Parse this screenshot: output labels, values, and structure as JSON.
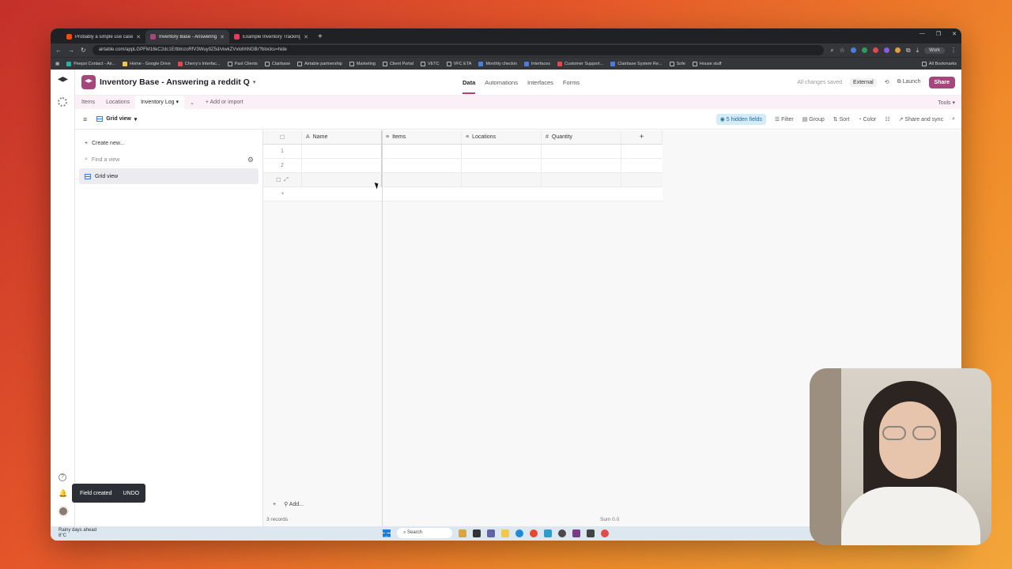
{
  "browser": {
    "tabs": [
      {
        "title": "Probably a simple use case, bu",
        "color": "#ff4500"
      },
      {
        "title": "Inventory Base - Answering a re",
        "color": "#a5477b"
      },
      {
        "title": "Example Inventory Tracking: In",
        "color": "#e63b5a"
      }
    ],
    "new_tab": "+",
    "url": "airtable.com/appLGPFM16kC2dc1E/tblnzoRfV3Wuy9Z5d/viwkZVvlohhNGBr?blocks=hide",
    "profile": "Work",
    "bookmarks": [
      "Peepsi Contact - Air...",
      "Home - Google Drive",
      "Cherry's Interfac...",
      "Past Clients",
      "Clairbase",
      "Airtable partnership",
      "Marketing",
      "Client Portal",
      "VETC",
      "VFC ETA",
      "Monthly checkin",
      "Interfaces",
      "Customer Support...",
      "Clairbase System Re...",
      "Sofe",
      "House stuff"
    ],
    "all_bookmarks": "All Bookmarks"
  },
  "base": {
    "name": "Inventory Base - Answering a reddit Q",
    "nav": [
      "Data",
      "Automations",
      "Interfaces",
      "Forms"
    ],
    "saved": "All changes saved",
    "external": "External",
    "launch": "Launch",
    "share": "Share"
  },
  "tables": {
    "items": [
      "Items",
      "Locations"
    ],
    "active": "Inventory Log",
    "add": "Add or import",
    "tools": "Tools"
  },
  "viewbar": {
    "view_name": "Grid view",
    "hidden_fields": "5 hidden fields",
    "filter": "Filter",
    "group": "Group",
    "sort": "Sort",
    "color": "Color",
    "share_sync": "Share and sync"
  },
  "sidebar": {
    "create": "Create new...",
    "find_placeholder": "Find a view",
    "views": [
      "Grid view"
    ]
  },
  "grid": {
    "columns": [
      {
        "name": "Name",
        "icon": "A"
      },
      {
        "name": "Items",
        "icon": "≡"
      },
      {
        "name": "Locations",
        "icon": "≡"
      },
      {
        "name": "Quantity",
        "icon": "#"
      }
    ],
    "rows": [
      "1",
      "2",
      ""
    ],
    "add_row": "+",
    "add_col": "+",
    "footer_add": "Add...",
    "records": "3 records",
    "sum": "Sum 0.0"
  },
  "toast": {
    "message": "Field created",
    "action": "UNDO"
  },
  "taskbar": {
    "weather": "Rainy days ahead",
    "temp": "8°C",
    "search": "Search"
  }
}
